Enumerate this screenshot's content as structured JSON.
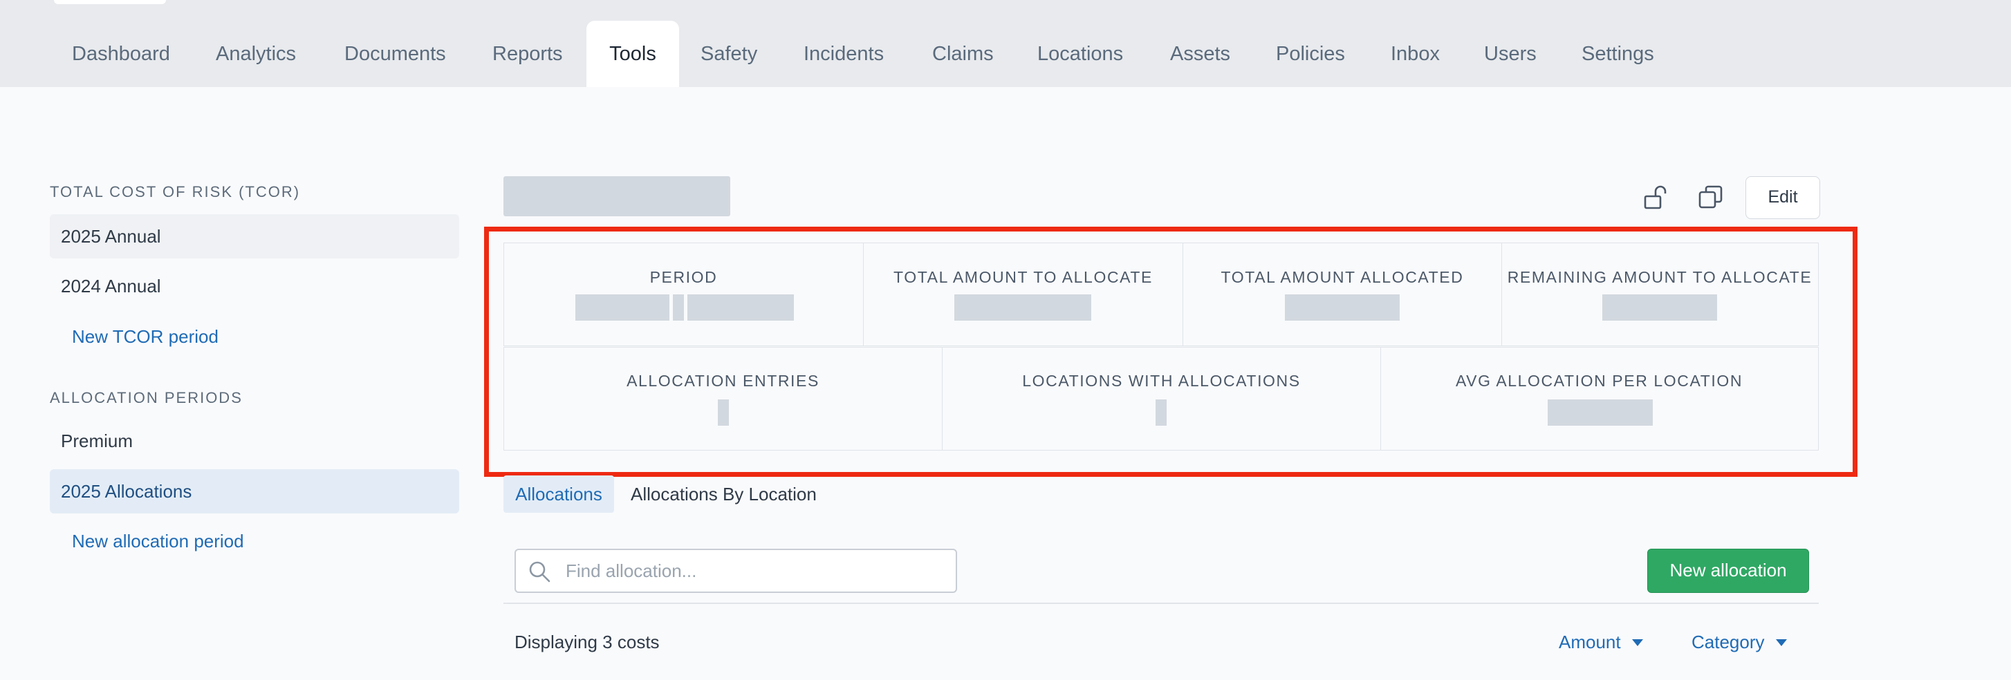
{
  "nav": {
    "tabs": [
      {
        "label": "Dashboard"
      },
      {
        "label": "Analytics"
      },
      {
        "label": "Documents"
      },
      {
        "label": "Reports"
      },
      {
        "label": "Tools",
        "active": true
      },
      {
        "label": "Safety"
      },
      {
        "label": "Incidents"
      },
      {
        "label": "Claims"
      },
      {
        "label": "Locations"
      },
      {
        "label": "Assets"
      },
      {
        "label": "Policies"
      },
      {
        "label": "Inbox"
      },
      {
        "label": "Users"
      },
      {
        "label": "Settings"
      }
    ]
  },
  "sidebar": {
    "tcor_heading": "TOTAL COST OF RISK (TCOR)",
    "tcor_items": [
      "2025 Annual",
      "2024 Annual"
    ],
    "new_tcor_link": "New TCOR period",
    "alloc_heading": "ALLOCATION PERIODS",
    "alloc_items": [
      "Premium",
      "2025 Allocations"
    ],
    "new_alloc_link": "New allocation period"
  },
  "header": {
    "edit_label": "Edit",
    "icons": [
      "unlock-icon",
      "copy-icon"
    ]
  },
  "stats": {
    "row1": [
      {
        "label": "PERIOD"
      },
      {
        "label": "TOTAL AMOUNT TO ALLOCATE"
      },
      {
        "label": "TOTAL AMOUNT ALLOCATED"
      },
      {
        "label": "REMAINING AMOUNT TO ALLOCATE"
      }
    ],
    "row2": [
      {
        "label": "ALLOCATION ENTRIES"
      },
      {
        "label": "LOCATIONS WITH ALLOCATIONS"
      },
      {
        "label": "AVG ALLOCATION PER LOCATION"
      }
    ]
  },
  "subtabs": {
    "active": "Allocations",
    "other": "Allocations By Location"
  },
  "search": {
    "placeholder": "Find allocation...",
    "value": ""
  },
  "actions": {
    "new_allocation": "New allocation"
  },
  "list": {
    "displaying": "Displaying 3 costs",
    "sort_amount": "Amount",
    "sort_category": "Category"
  },
  "colors": {
    "accent_blue": "#1f6bb5",
    "primary_green": "#2fa864",
    "highlight_red": "#ee2a12"
  }
}
